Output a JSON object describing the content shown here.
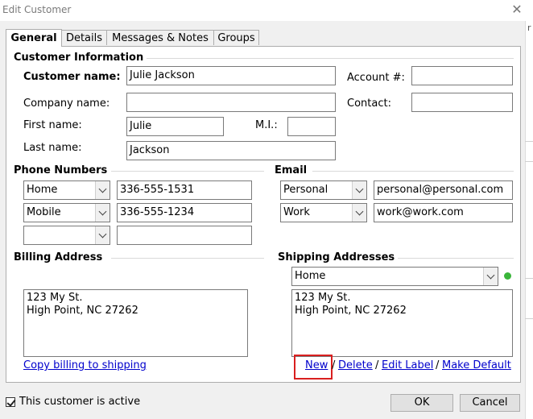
{
  "window": {
    "title": "Edit Customer"
  },
  "tabs": [
    "General",
    "Details",
    "Messages & Notes",
    "Groups"
  ],
  "customer_info": {
    "section_title": "Customer Information",
    "customer_name_label": "Customer name:",
    "customer_name": "Julie Jackson",
    "company_name_label": "Company name:",
    "company_name": "",
    "first_name_label": "First name:",
    "first_name": "Julie",
    "mi_label": "M.I.:",
    "mi": "",
    "last_name_label": "Last name:",
    "last_name": "Jackson",
    "account_label": "Account #:",
    "account": "",
    "contact_label": "Contact:",
    "contact": ""
  },
  "phones": {
    "section_title": "Phone Numbers",
    "rows": [
      {
        "type": "Home",
        "number": "336-555-1531"
      },
      {
        "type": "Mobile",
        "number": "336-555-1234"
      },
      {
        "type": "",
        "number": ""
      }
    ]
  },
  "email": {
    "section_title": "Email",
    "rows": [
      {
        "type": "Personal",
        "address": "personal@personal.com"
      },
      {
        "type": "Work",
        "address": "work@work.com"
      }
    ]
  },
  "billing": {
    "section_title": "Billing Address",
    "line1": "123 My St.",
    "line2": "High Point, NC  27262",
    "copy_link": "Copy billing to shipping"
  },
  "shipping": {
    "section_title": "Shipping Addresses",
    "selected": "Home",
    "line1": "123 My St.",
    "line2": "High Point, NC  27262",
    "status_color": "#3ab53a",
    "links": {
      "new": "New",
      "delete": "Delete",
      "edit_label": "Edit Label",
      "make_default": "Make Default"
    },
    "separator": "/"
  },
  "footer": {
    "active_label": "This customer is active",
    "active_checked": true,
    "ok": "OK",
    "cancel": "Cancel"
  }
}
